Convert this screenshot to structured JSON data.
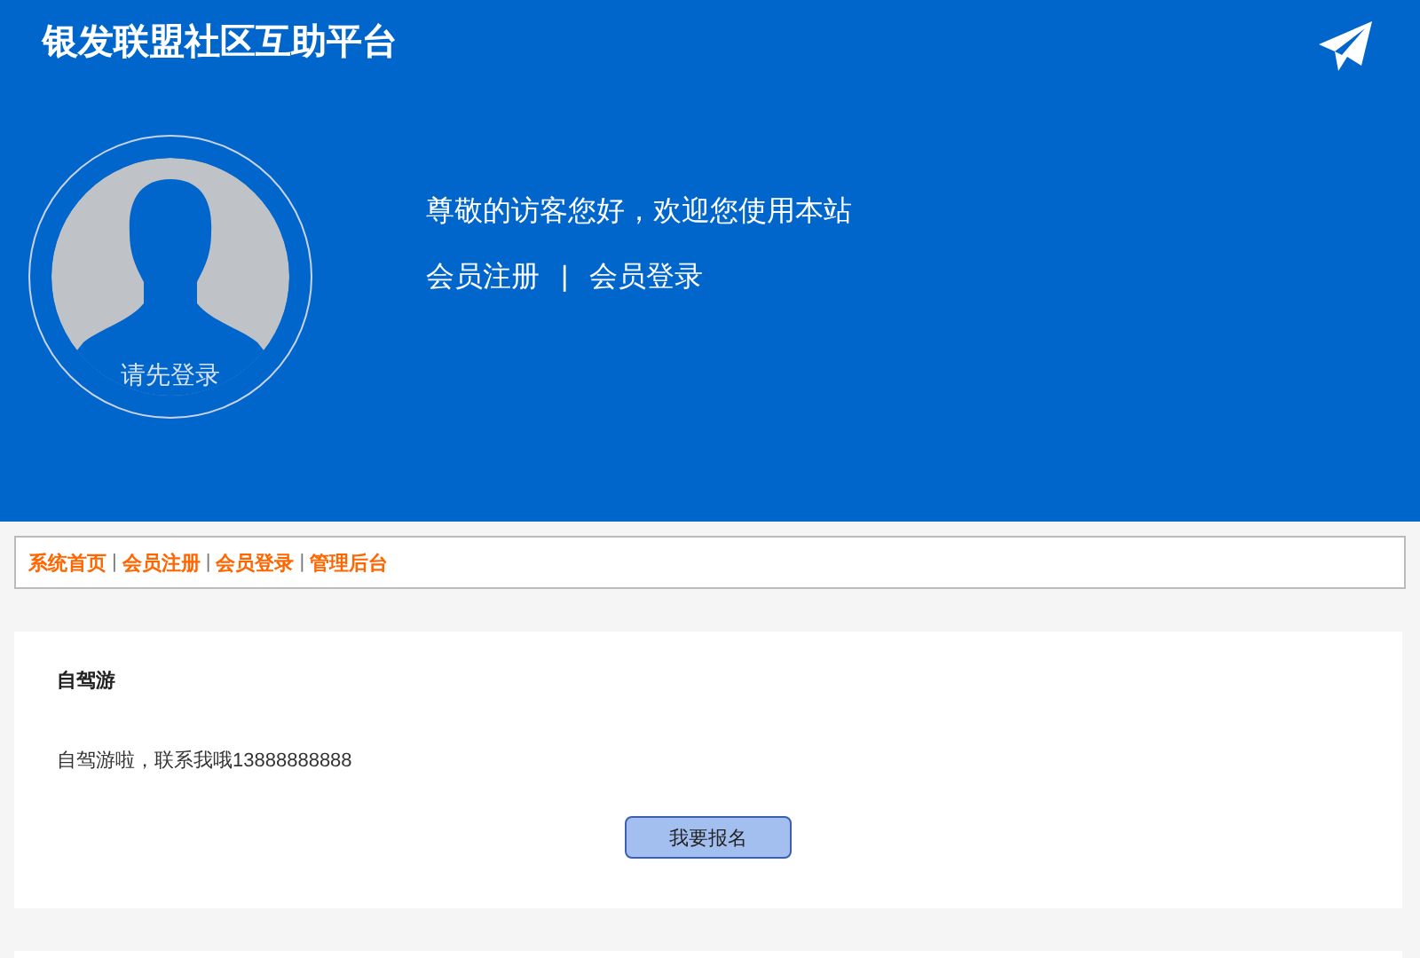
{
  "header": {
    "title": "银发联盟社区互助平台",
    "avatar_caption": "请先登录",
    "greeting": "尊敬的访客您好，欢迎您使用本站",
    "links": [
      "会员注册",
      "会员登录"
    ],
    "separator": "|"
  },
  "nav": {
    "links": [
      "系统首页",
      "会员注册",
      "会员登录",
      "管理后台"
    ],
    "separator": "|"
  },
  "posts": [
    {
      "title": "自驾游",
      "body": "自驾游啦，联系我哦13888888888",
      "button": "我要报名"
    }
  ]
}
